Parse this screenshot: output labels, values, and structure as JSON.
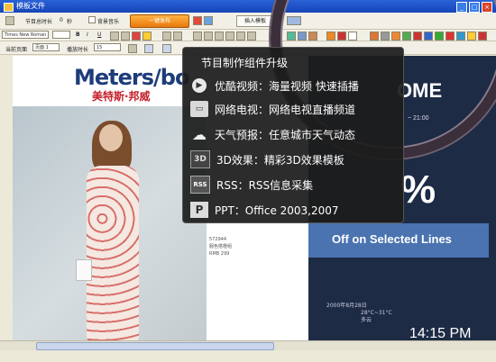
{
  "window": {
    "title": "模板文件"
  },
  "toolbar1": {
    "segment_label": "节目总时长",
    "segment_value": "0",
    "segment_unit": "秒",
    "bg_music_label": "背景音乐",
    "publish_label": "一键发布",
    "insert_label": "插入模板"
  },
  "toolbar2": {
    "font_name": "Times New Roman"
  },
  "toolbar3": {
    "page_label": "当前页面",
    "page_value": "页面 1",
    "duration_label": "播放时长",
    "duration_value": "15"
  },
  "document": {
    "brand_logo": "Meters/bo",
    "brand_cn": "美特斯·邦威",
    "product_lines": [
      "572944",
      "服色搭橙组",
      "RMB 299"
    ]
  },
  "preview": {
    "headline": "OME",
    "time_range": "~ 21:00",
    "percent": "%",
    "banner": "Off on Selected Lines",
    "weather_date": "2000年8月28日",
    "weather_temp": "28°C~31°C",
    "weather_desc": "多云",
    "clock": "14:15 PM"
  },
  "popup": {
    "title": "节目制作组件升级",
    "items": [
      {
        "icon": "play-icon",
        "label": "优酷视频：海量视频 快速插播"
      },
      {
        "icon": "tv-icon",
        "label": "网络电视：网络电视直播频道"
      },
      {
        "icon": "weather-cloud-icon",
        "label": "天气预报：任意城市天气动态"
      },
      {
        "icon": "3d-icon",
        "label": "3D效果：精彩3D效果模板"
      },
      {
        "icon": "rss-icon",
        "label": "RSS：RSS信息采集"
      },
      {
        "icon": "ppt-icon",
        "label": "PPT：Office 2003,2007"
      }
    ]
  },
  "colors": {
    "titlebar": "#1545b8",
    "publish": "#e8780d",
    "popup_bg": "#1c1c1c",
    "banner": "#4a73b0"
  }
}
